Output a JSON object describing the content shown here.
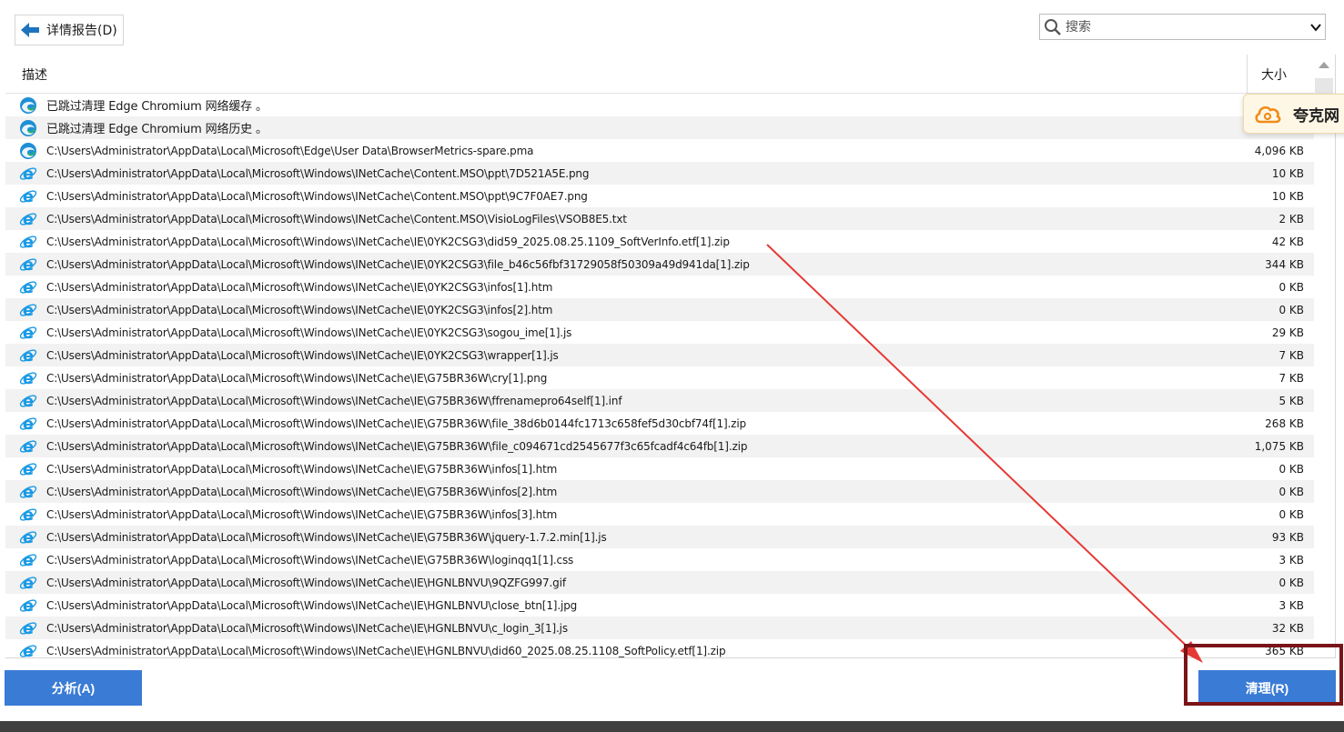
{
  "toolbar": {
    "details_label": "详情报告(D)",
    "search_placeholder": "搜索"
  },
  "columns": {
    "description": "描述",
    "size": "大小"
  },
  "rows": [
    {
      "icon": "edge-icon",
      "text": "已跳过清理 Edge Chromium 网络缓存 。",
      "size": ""
    },
    {
      "icon": "edge-icon",
      "text": "已跳过清理 Edge Chromium 网络历史 。",
      "size": ""
    },
    {
      "icon": "edge-icon",
      "text": "C:\\Users\\Administrator\\AppData\\Local\\Microsoft\\Edge\\User Data\\BrowserMetrics-spare.pma",
      "size": "4,096 KB"
    },
    {
      "icon": "ie-icon",
      "text": "C:\\Users\\Administrator\\AppData\\Local\\Microsoft\\Windows\\INetCache\\Content.MSO\\ppt\\7D521A5E.png",
      "size": "10 KB"
    },
    {
      "icon": "ie-icon",
      "text": "C:\\Users\\Administrator\\AppData\\Local\\Microsoft\\Windows\\INetCache\\Content.MSO\\ppt\\9C7F0AE7.png",
      "size": "10 KB"
    },
    {
      "icon": "ie-icon",
      "text": "C:\\Users\\Administrator\\AppData\\Local\\Microsoft\\Windows\\INetCache\\Content.MSO\\VisioLogFiles\\VSOB8E5.txt",
      "size": "2 KB"
    },
    {
      "icon": "ie-icon",
      "text": "C:\\Users\\Administrator\\AppData\\Local\\Microsoft\\Windows\\INetCache\\IE\\0YK2CSG3\\did59_2025.08.25.1109_SoftVerInfo.etf[1].zip",
      "size": "42 KB"
    },
    {
      "icon": "ie-icon",
      "text": "C:\\Users\\Administrator\\AppData\\Local\\Microsoft\\Windows\\INetCache\\IE\\0YK2CSG3\\file_b46c56fbf31729058f50309a49d941da[1].zip",
      "size": "344 KB"
    },
    {
      "icon": "ie-icon",
      "text": "C:\\Users\\Administrator\\AppData\\Local\\Microsoft\\Windows\\INetCache\\IE\\0YK2CSG3\\infos[1].htm",
      "size": "0 KB"
    },
    {
      "icon": "ie-icon",
      "text": "C:\\Users\\Administrator\\AppData\\Local\\Microsoft\\Windows\\INetCache\\IE\\0YK2CSG3\\infos[2].htm",
      "size": "0 KB"
    },
    {
      "icon": "ie-icon",
      "text": "C:\\Users\\Administrator\\AppData\\Local\\Microsoft\\Windows\\INetCache\\IE\\0YK2CSG3\\sogou_ime[1].js",
      "size": "29 KB"
    },
    {
      "icon": "ie-icon",
      "text": "C:\\Users\\Administrator\\AppData\\Local\\Microsoft\\Windows\\INetCache\\IE\\0YK2CSG3\\wrapper[1].js",
      "size": "7 KB"
    },
    {
      "icon": "ie-icon",
      "text": "C:\\Users\\Administrator\\AppData\\Local\\Microsoft\\Windows\\INetCache\\IE\\G75BR36W\\cry[1].png",
      "size": "7 KB"
    },
    {
      "icon": "ie-icon",
      "text": "C:\\Users\\Administrator\\AppData\\Local\\Microsoft\\Windows\\INetCache\\IE\\G75BR36W\\ffrenamepro64self[1].inf",
      "size": "5 KB"
    },
    {
      "icon": "ie-icon",
      "text": "C:\\Users\\Administrator\\AppData\\Local\\Microsoft\\Windows\\INetCache\\IE\\G75BR36W\\file_38d6b0144fc1713c658fef5d30cbf74f[1].zip",
      "size": "268 KB"
    },
    {
      "icon": "ie-icon",
      "text": "C:\\Users\\Administrator\\AppData\\Local\\Microsoft\\Windows\\INetCache\\IE\\G75BR36W\\file_c094671cd2545677f3c65fcadf4c64fb[1].zip",
      "size": "1,075 KB"
    },
    {
      "icon": "ie-icon",
      "text": "C:\\Users\\Administrator\\AppData\\Local\\Microsoft\\Windows\\INetCache\\IE\\G75BR36W\\infos[1].htm",
      "size": "0 KB"
    },
    {
      "icon": "ie-icon",
      "text": "C:\\Users\\Administrator\\AppData\\Local\\Microsoft\\Windows\\INetCache\\IE\\G75BR36W\\infos[2].htm",
      "size": "0 KB"
    },
    {
      "icon": "ie-icon",
      "text": "C:\\Users\\Administrator\\AppData\\Local\\Microsoft\\Windows\\INetCache\\IE\\G75BR36W\\infos[3].htm",
      "size": "0 KB"
    },
    {
      "icon": "ie-icon",
      "text": "C:\\Users\\Administrator\\AppData\\Local\\Microsoft\\Windows\\INetCache\\IE\\G75BR36W\\jquery-1.7.2.min[1].js",
      "size": "93 KB"
    },
    {
      "icon": "ie-icon",
      "text": "C:\\Users\\Administrator\\AppData\\Local\\Microsoft\\Windows\\INetCache\\IE\\G75BR36W\\loginqq1[1].css",
      "size": "3 KB"
    },
    {
      "icon": "ie-icon",
      "text": "C:\\Users\\Administrator\\AppData\\Local\\Microsoft\\Windows\\INetCache\\IE\\HGNLBNVU\\9QZFG997.gif",
      "size": "0 KB"
    },
    {
      "icon": "ie-icon",
      "text": "C:\\Users\\Administrator\\AppData\\Local\\Microsoft\\Windows\\INetCache\\IE\\HGNLBNVU\\close_btn[1].jpg",
      "size": "3 KB"
    },
    {
      "icon": "ie-icon",
      "text": "C:\\Users\\Administrator\\AppData\\Local\\Microsoft\\Windows\\INetCache\\IE\\HGNLBNVU\\c_login_3[1].js",
      "size": "32 KB"
    },
    {
      "icon": "ie-icon",
      "text": "C:\\Users\\Administrator\\AppData\\Local\\Microsoft\\Windows\\INetCache\\IE\\HGNLBNVU\\did60_2025.08.25.1108_SoftPolicy.etf[1].zip",
      "size": "365 KB"
    }
  ],
  "side_widget": {
    "label": "夸克网",
    "icon": "cloud-icon"
  },
  "buttons": {
    "analyze": "分析(A)",
    "clean": "清理(R)"
  },
  "colors": {
    "accent": "#3a7bd5",
    "highlight": "#7a1418",
    "arrow": "#e53935"
  }
}
